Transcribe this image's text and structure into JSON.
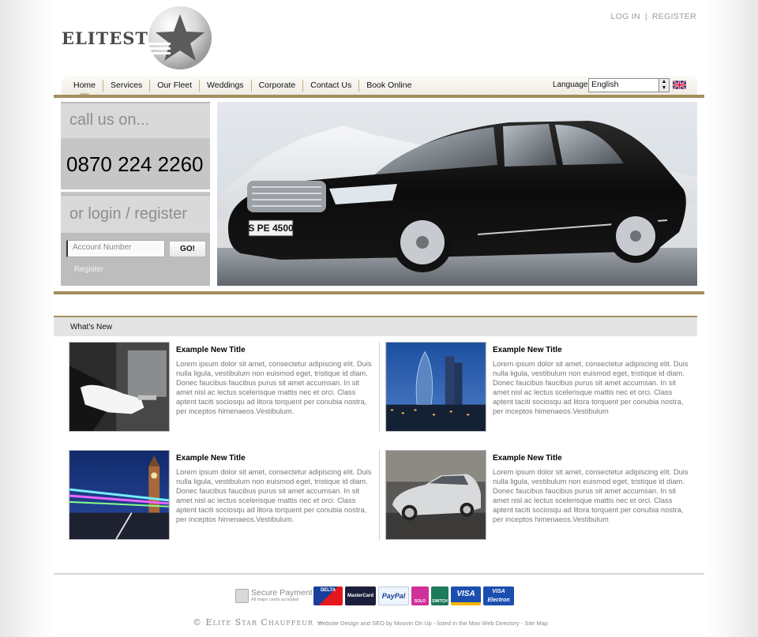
{
  "header": {
    "logo_text": "ELITESTAR",
    "login_link": "LOG IN",
    "separator": "|",
    "register_link": "REGISTER"
  },
  "nav": {
    "items": [
      "Home",
      "Services",
      "Our Fleet",
      "Weddings",
      "Corporate",
      "Contact Us",
      "Book Online"
    ],
    "active": "Home",
    "language_label": "Language:",
    "language_value": "English",
    "flag_icon": "uk-flag-icon"
  },
  "sidebar": {
    "call_heading": "call us on...",
    "phone": "0870 224 2260",
    "login_heading": "or login / register",
    "account_placeholder": "Account Number",
    "go_label": "GO!",
    "register_label": "Register"
  },
  "hero": {
    "plate": "S PE 4500"
  },
  "whats_new": {
    "heading": "What's New",
    "articles": [
      {
        "title": "Example New Title",
        "body": "Lorem ipsum dolor sit amet, consectetur adipiscing elit. Duis nulla ligula, vestibulum non euismod eget, tristique id diam. Donec faucibus faucibus purus sit amet accumsan. In sit amet nisl ac lectus scelerisque mattis nec et orci. Class aptent taciti sociosqu ad litora torquent per conubia nostra, per inceptos himenaeos.Vestibulum.",
        "image": "chauffeur-door-photo"
      },
      {
        "title": "Example New Title",
        "body": "Lorem ipsum dolor sit amet, consectetur adipiscing elit. Duis nulla ligula, vestibulum non euismod eget, tristique id diam. Donec faucibus faucibus purus sit amet accumsan. In sit amet nisl ac lectus scelerisque mattis nec et orci. Class aptent taciti sociosqu ad litora torquent per conubia nostra, per inceptos himenaeos.Vestibulum",
        "image": "london-skyline-photo"
      },
      {
        "title": "Example New Title",
        "body": "Lorem ipsum dolor sit amet, consectetur adipiscing elit. Duis nulla ligula, vestibulum non euismod eget, tristique id diam. Donec faucibus faucibus purus sit amet accumsan. In sit amet nisl ac lectus scelerisque mattis nec et orci. Class aptent taciti sociosqu ad litora torquent per conubia nostra, per inceptos himenaeos.Vestibulum.",
        "image": "big-ben-night-photo"
      },
      {
        "title": "Example New Title",
        "body": "Lorem ipsum dolor sit amet, consectetur adipiscing elit. Duis nulla ligula, vestibulum non euismod eget, tristique id diam. Donec faucibus faucibus purus sit amet accumsan. In sit amet nisl ac lectus scelerisque mattis nec et orci. Class aptent taciti sociosqu ad litora torquent per conubia nostra, per inceptos himenaeos.Vestibulum",
        "image": "silver-car-photo"
      }
    ]
  },
  "footer": {
    "secure_title": "Secure Payment",
    "secure_sub": "All major cards accepted",
    "cards": [
      "DELTA",
      "MasterCard",
      "PayPal",
      "SOLO",
      "SWITCH",
      "VISA",
      "VISA Electron"
    ],
    "copyright": "© Elite Star Chauffeur",
    "dash": "–",
    "credits": "Website Design and SEO by Moovin On Up - listed in the Moo Web Directory - Site Map"
  },
  "colors": {
    "gold_accent": "#a38f5e",
    "panel_grey": "#c8c8c8",
    "text_grey": "#777777"
  }
}
